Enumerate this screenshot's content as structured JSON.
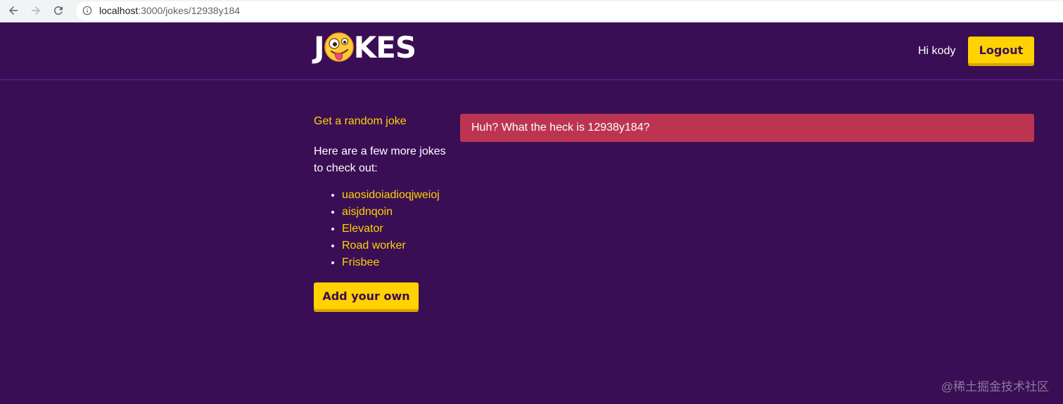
{
  "browser": {
    "url_host": "localhost",
    "url_path": ":3000/jokes/12938y184"
  },
  "header": {
    "logo_left": "J",
    "logo_right": "KES",
    "greeting": "Hi kody",
    "logout_label": "Logout"
  },
  "sidebar": {
    "random_link": "Get a random joke",
    "intro": "Here are a few more jokes to check out:",
    "jokes": [
      {
        "name": "uaosidoiadioqjweioj"
      },
      {
        "name": "aisjdnqoin"
      },
      {
        "name": "Elevator"
      },
      {
        "name": "Road worker"
      },
      {
        "name": "Frisbee"
      }
    ],
    "add_label": "Add your own"
  },
  "main": {
    "error_message": "Huh? What the heck is 12938y184?"
  },
  "watermark": "@稀土掘金技术社区",
  "colors": {
    "background": "#3a0e55",
    "accent": "#ffd200",
    "error": "#bc3550"
  }
}
